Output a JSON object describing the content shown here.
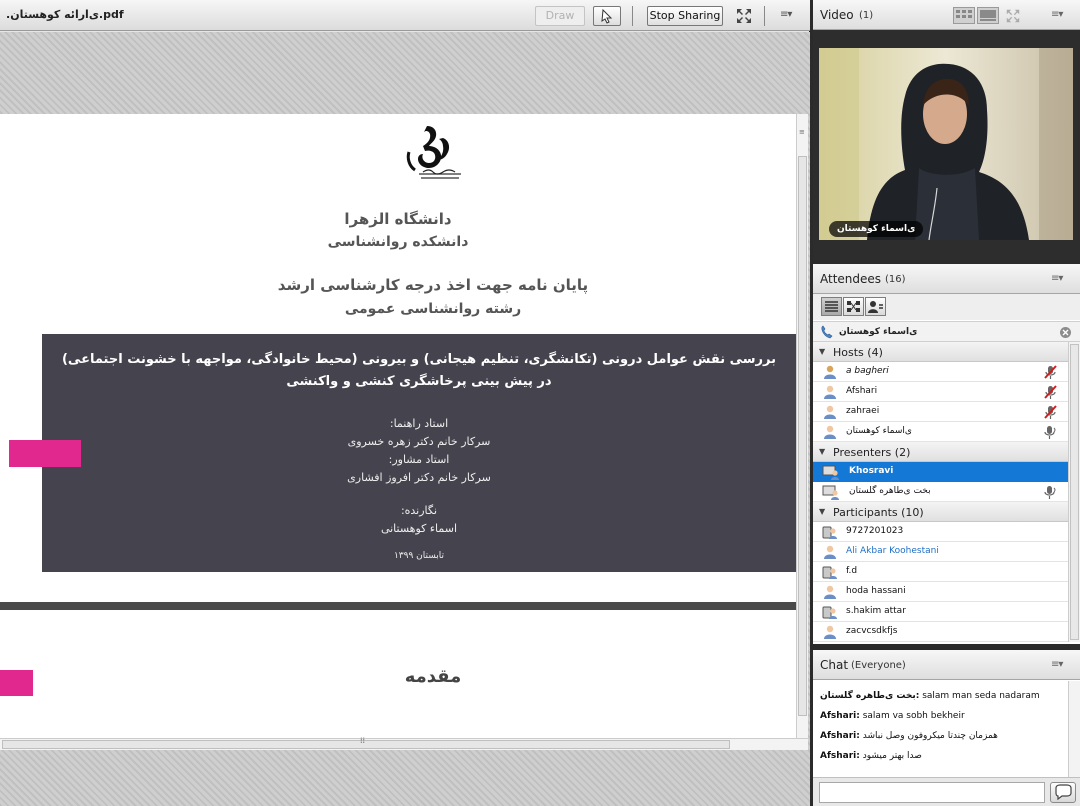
{
  "share": {
    "doc_title": ".ی‌ارائه کوهستان.pdf",
    "draw_label": "Draw",
    "stop_sharing_label": "Stop Sharing",
    "menu_glyph": "≡▾"
  },
  "slide1": {
    "university": "دانشگاه الزهرا",
    "faculty": "دانشکده روانشناسی",
    "degree": "پایان نامه جهت اخذ درجه کارشناسی ارشد",
    "major": "رشته روانشناسی عمومی",
    "thesis_title_1": "بررسی نقش عوامل درونی (تکانشگری، تنظیم هیجانی) و بیرونی (محیط خانوادگی، مواجهه با خشونت اجتماعی)",
    "thesis_title_2": "در پیش بینی پرخاشگری کنشی و واکنشی",
    "advisor_label": "استاد راهنما:",
    "advisor_name": "سرکار خانم دکتر زهره خسروی",
    "consultant_label": "استاد مشاور:",
    "consultant_name": "سرکار خانم دکتر افروز افشاری",
    "author_label": "نگارنده:",
    "author_name": "اسماء کوهستانی",
    "date": "تابستان ۱۳۹۹"
  },
  "slide2": {
    "heading": "مقدمه"
  },
  "video": {
    "title": "Video",
    "count": "(1)",
    "speaker_name": "ی‌اسماء کوهستان",
    "menu_glyph": "≡▾"
  },
  "attendees": {
    "title": "Attendees",
    "count": "(16)",
    "menu_glyph": "≡▾",
    "status_name": "ی‌اسماء کوهستان",
    "hosts_label": "Hosts (4)",
    "hosts": [
      {
        "name": "a bagheri"
      },
      {
        "name": "Afshari"
      },
      {
        "name": "zahraei"
      },
      {
        "name": "ی‌اسماء کوهستان"
      }
    ],
    "presenters_label": "Presenters (2)",
    "presenters": [
      {
        "name": "Khosravi"
      },
      {
        "name": "بخت ی‌طاهره گلستان"
      }
    ],
    "participants_label": "Participants (10)",
    "participants": [
      {
        "name": "9727201023"
      },
      {
        "name": "Ali Akbar Koohestani"
      },
      {
        "name": "f.d"
      },
      {
        "name": "hoda hassani"
      },
      {
        "name": "s.hakim attar"
      },
      {
        "name": "zacvcsdkfjs"
      }
    ]
  },
  "chat": {
    "title": "Chat",
    "scope": "(Everyone)",
    "menu_glyph": "≡▾",
    "messages": [
      {
        "sender": "بخت ی‌طاهره گلستان:",
        "text": "salam man seda nadaram"
      },
      {
        "sender": "Afshari:",
        "text": "salam va sobh bekheir"
      },
      {
        "sender": "Afshari:",
        "text": "همزمان چندتا میکروفون وصل نباشد"
      },
      {
        "sender": "Afshari:",
        "text": "صدا بهتر میشود"
      }
    ],
    "input_value": ""
  },
  "colors": {
    "accent_pink": "#e0288e",
    "selection_blue": "#1478d6",
    "slide_band": "#45444e",
    "link_blue": "#1f6fc5"
  },
  "icons": [
    "pointer-icon",
    "fullscreen-icon",
    "menu-icon",
    "grid-view-icon",
    "list-view-icon",
    "phone-icon",
    "close-icon",
    "user-icon",
    "host-icon",
    "mic-icon",
    "mic-muted-icon",
    "presenter-icon",
    "send-icon"
  ]
}
